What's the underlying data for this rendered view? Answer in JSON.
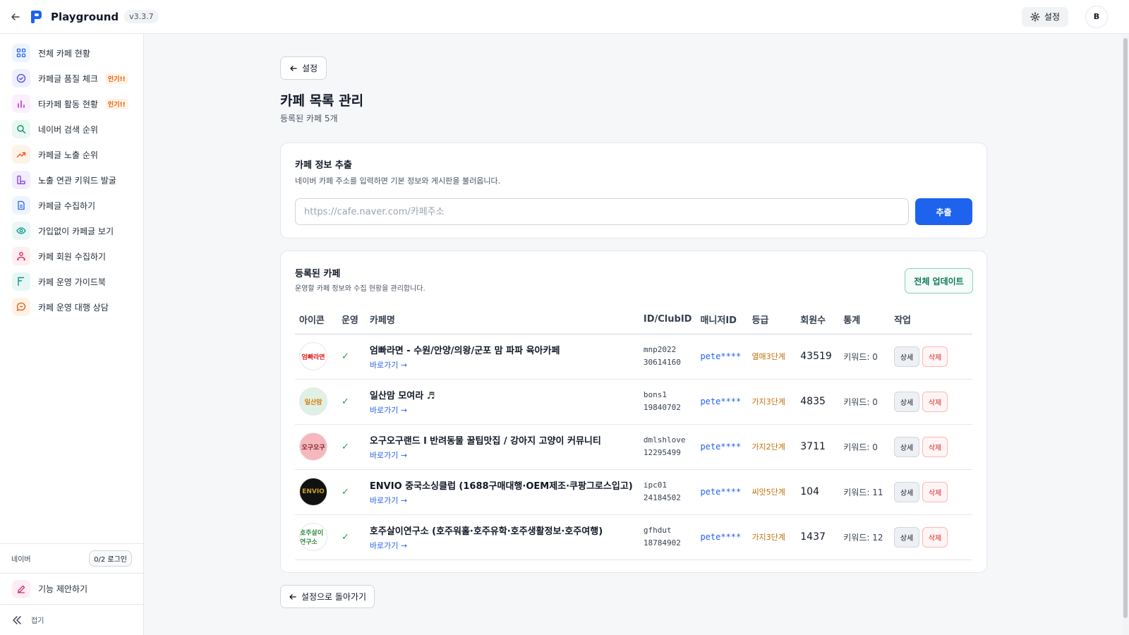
{
  "app": {
    "title": "Playground",
    "version": "v3.3.7"
  },
  "header": {
    "settings_label": "설정",
    "avatar_initial": "B"
  },
  "sidebar": {
    "items": [
      {
        "label": "전체 카페 현황",
        "icon": "grid-icon",
        "color": "#2563eb",
        "bg": "#eef4ff",
        "badge": ""
      },
      {
        "label": "카페글 품질 체크",
        "icon": "check-circle-icon",
        "color": "#4f46e5",
        "bg": "#eef0ff",
        "badge": "인기!!"
      },
      {
        "label": "타카페 활동 현황",
        "icon": "bar-chart-icon",
        "color": "#c026d3",
        "bg": "#fbeefd",
        "badge": "인기!!"
      },
      {
        "label": "네이버 검색 순위",
        "icon": "search-icon",
        "color": "#059669",
        "bg": "#e9f8f1",
        "badge": ""
      },
      {
        "label": "카페글 노출 순위",
        "icon": "trending-up-icon",
        "color": "#ea580c",
        "bg": "#fff2e7",
        "badge": ""
      },
      {
        "label": "노출 연관 키워드 발굴",
        "icon": "keyword-icon",
        "color": "#7c3aed",
        "bg": "#f3edff",
        "badge": ""
      },
      {
        "label": "카페글 수집하기",
        "icon": "document-icon",
        "color": "#2563eb",
        "bg": "#eef4ff",
        "badge": ""
      },
      {
        "label": "가입없이 카페글 보기",
        "icon": "eye-icon",
        "color": "#0d9488",
        "bg": "#e8f7f5",
        "badge": ""
      },
      {
        "label": "카페 회원 수집하기",
        "icon": "users-icon",
        "color": "#e11d48",
        "bg": "#fdeef1",
        "badge": ""
      },
      {
        "label": "카페 운영 가이드북",
        "icon": "book-icon",
        "color": "#0d9488",
        "bg": "#e8f7f5",
        "badge": ""
      },
      {
        "label": "카페 운영 대행 상담",
        "icon": "chat-icon",
        "color": "#ea580c",
        "bg": "#fff2e7",
        "badge": ""
      }
    ],
    "naver_label": "네이버",
    "login_status": "0/2 로그인",
    "suggest_label": "기능 제안하기",
    "collapse_label": "접기"
  },
  "page": {
    "back_label": "설정",
    "title": "카페 목록 관리",
    "subtitle": "등록된 카페 5개",
    "bottom_back_label": "설정으로 돌아가기"
  },
  "extract": {
    "title": "카페 정보 추출",
    "description": "네이버 카페 주소를 입력하면 기본 정보와 게시판을 불러옵니다.",
    "placeholder": "https://cafe.naver.com/카페주소",
    "value": "",
    "button_label": "추출"
  },
  "registered": {
    "title": "등록된 카페",
    "description": "운영할 카페 정보와 수집 현황을 관리합니다.",
    "update_all_label": "전체 업데이트",
    "columns": [
      "아이콘",
      "운영",
      "카페명",
      "ID/ClubID",
      "매니저ID",
      "등급",
      "회원수",
      "통계",
      "작업"
    ],
    "link_label": "바로가기 →",
    "detail_label": "상세",
    "delete_label": "삭제",
    "rows": [
      {
        "name": "엄빠라면 - 수원/안양/의왕/군포 맘 파파 육아카페",
        "id": "mnp2022",
        "club_id": "30614160",
        "manager": "pete****",
        "grade": "열매3단계",
        "members": "43519",
        "stats": "키워드: 0",
        "icon_text": "엄빠라면",
        "icon_bg": "#ffffff",
        "icon_fg": "#e02020",
        "operating": "✓"
      },
      {
        "name": "일산맘 모여라 ♬",
        "id": "bons1",
        "club_id": "19840702",
        "manager": "pete****",
        "grade": "가지3단계",
        "members": "4835",
        "stats": "키워드: 0",
        "icon_text": "일산맘",
        "icon_bg": "#dff1e4",
        "icon_fg": "#d97706",
        "operating": "✓"
      },
      {
        "name": "오구오구랜드 l 반려동물 꿀팁맛집 / 강아지 고양이 커뮤니티",
        "id": "dmlshlove",
        "club_id": "12295499",
        "manager": "pete****",
        "grade": "가지2단계",
        "members": "3711",
        "stats": "키워드: 0",
        "icon_text": "오구오구",
        "icon_bg": "#f6b8bd",
        "icon_fg": "#7a1f2b",
        "operating": "✓"
      },
      {
        "name": "ENVIO 중국소싱클럽 (1688구매대행·OEM제조·쿠팡그로스입고)",
        "id": "ipc01",
        "club_id": "24184502",
        "manager": "pete****",
        "grade": "씨앗5단계",
        "members": "104",
        "stats": "키워드: 11",
        "icon_text": "ENVIO",
        "icon_bg": "#111111",
        "icon_fg": "#c9a227",
        "operating": "✓"
      },
      {
        "name": "호주살이연구소 (호주워홀·호주유학·호주생활정보·호주여행)",
        "id": "gfhdut",
        "club_id": "18784902",
        "manager": "pete****",
        "grade": "가지3단계",
        "members": "1437",
        "stats": "키워드: 12",
        "icon_text": "호주살이연구소",
        "icon_bg": "#ffffff",
        "icon_fg": "#2b8a3e",
        "operating": "✓"
      }
    ]
  }
}
